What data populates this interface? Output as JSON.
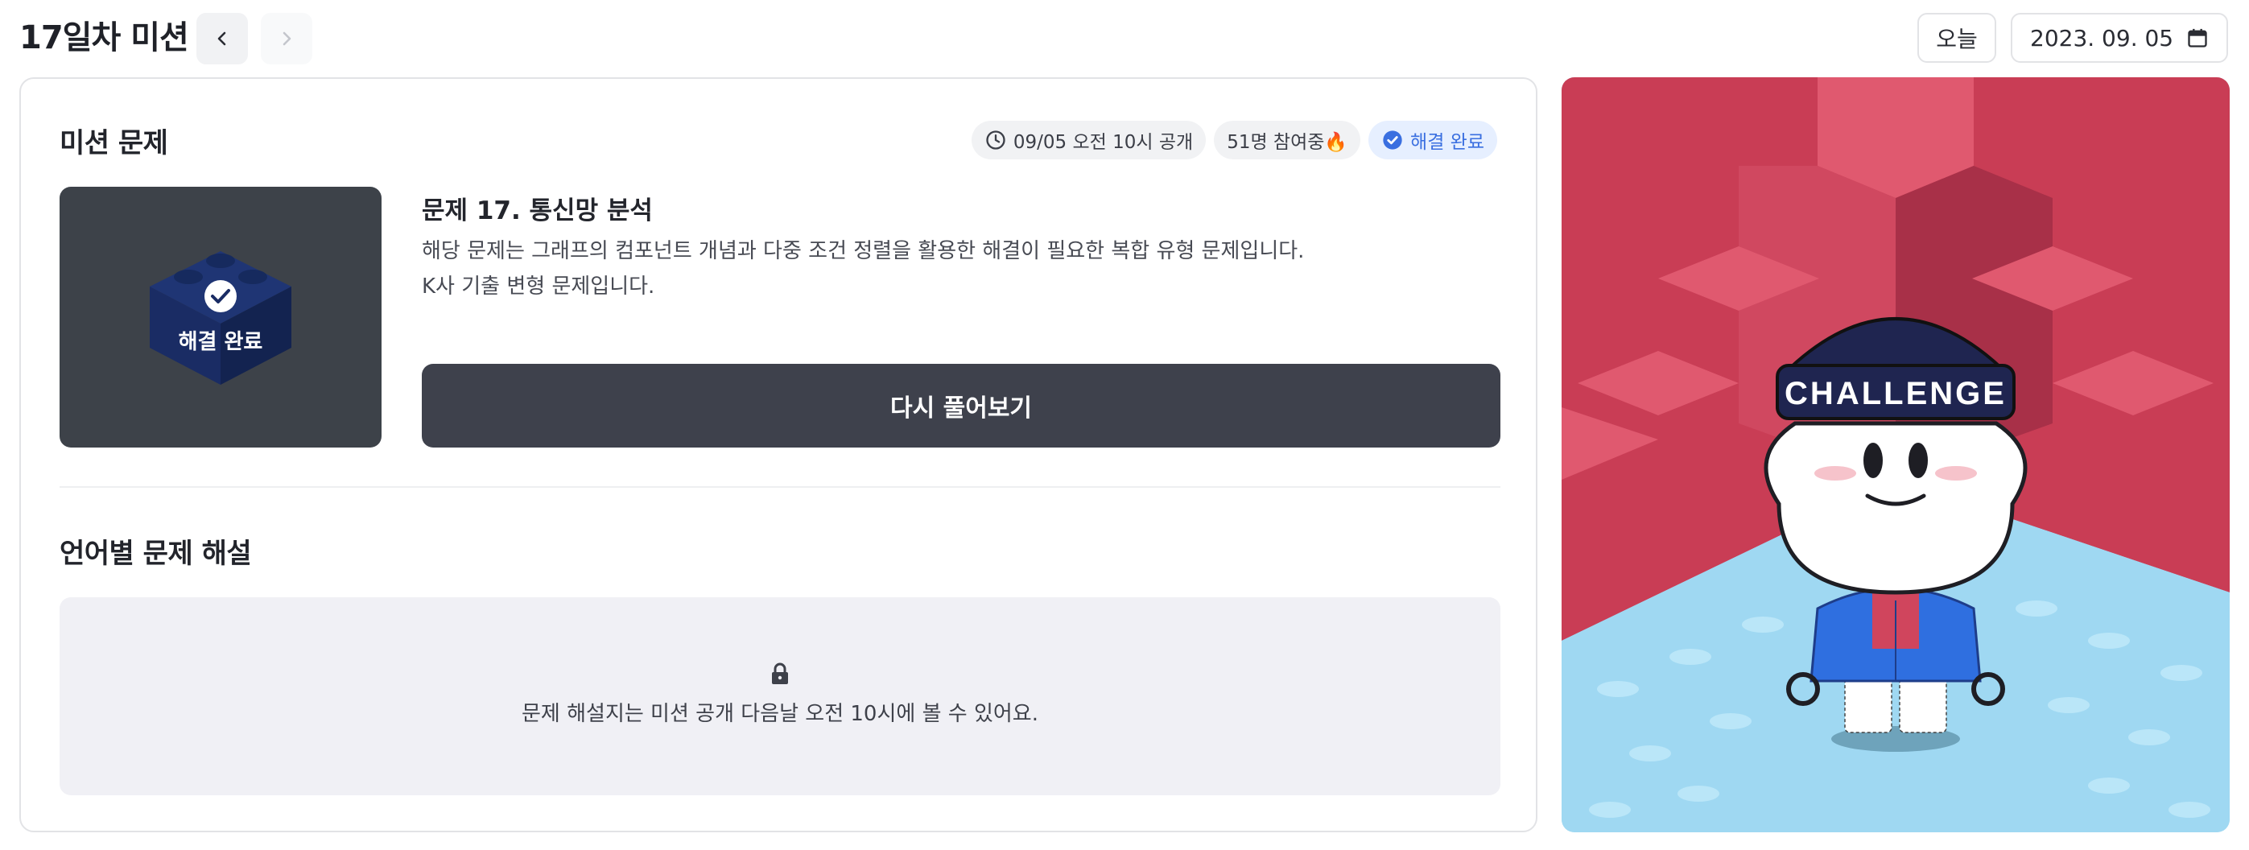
{
  "header": {
    "title": "17일차 미션",
    "today_label": "오늘",
    "date": "2023. 09. 05"
  },
  "icons": {
    "prev": "chevron-left-icon",
    "next": "chevron-right-icon",
    "calendar": "calendar-icon",
    "clock": "clock-icon",
    "check": "check-circle-icon",
    "lock": "lock-icon"
  },
  "mission": {
    "section_title": "미션 문제",
    "badges": {
      "release": "09/05 오전 10시 공개",
      "participants": "51명 참여중🔥",
      "status": "해결 완료"
    },
    "thumbnail_label": "해결 완료",
    "problem_title": "문제 17. 통신망 분석",
    "description_line1": "해당 문제는 그래프의 컴포넌트 개념과 다중 조건 정렬을 활용한 해결이 필요한 복합 유형 문제입니다.",
    "description_line2": "K사 기출 변형 문제입니다.",
    "retry_button": "다시 풀어보기"
  },
  "solution": {
    "section_title": "언어별 문제 해설",
    "locked_message": "문제 해설지는 미션 공개 다음날 오전 10시에 볼 수 있어요."
  },
  "illustration": {
    "hat_text": "CHALLENGE"
  },
  "colors": {
    "accent": "#3a6fe0",
    "button_dark": "#3e414c",
    "lego_red": "#d9475d",
    "sky": "#b4e4f7"
  }
}
